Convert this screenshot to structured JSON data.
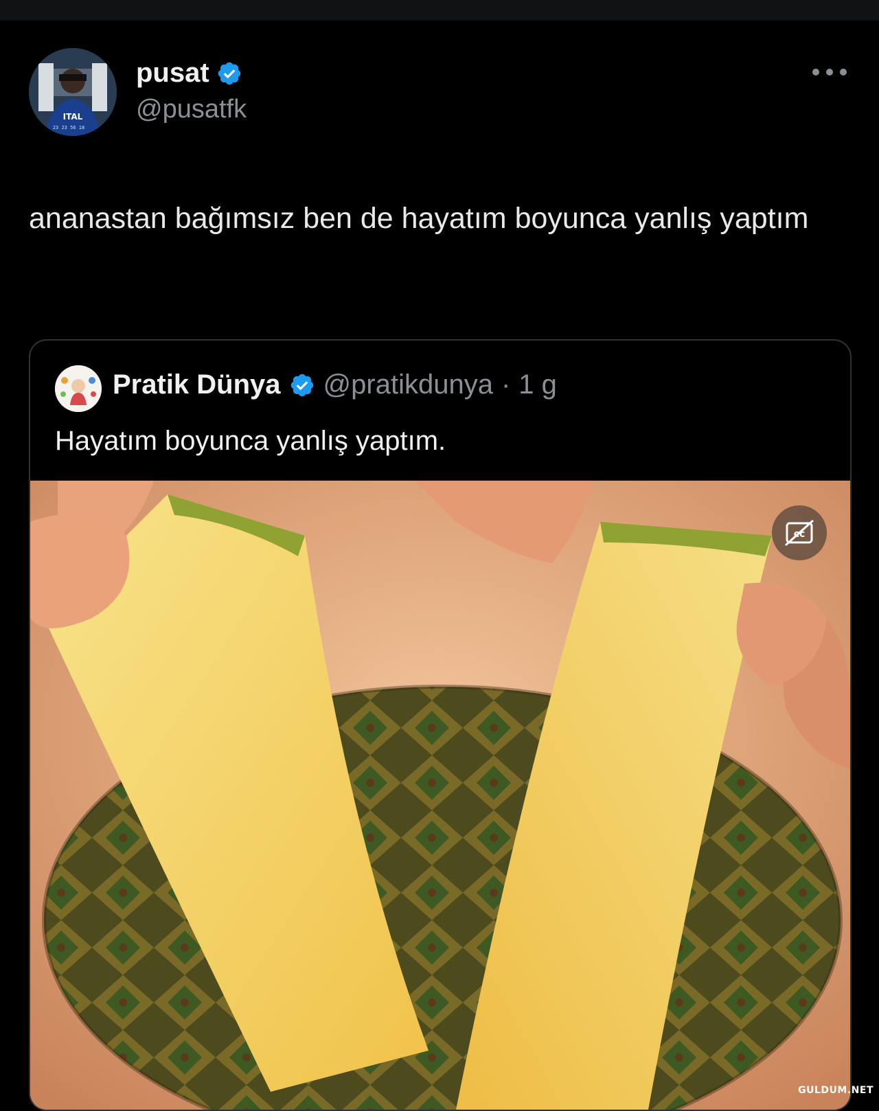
{
  "colors": {
    "background": "#000000",
    "verified": "#1d9bf0",
    "muted_text": "#8b9096"
  },
  "tweet": {
    "author_name": "pusat",
    "author_handle": "@pusatfk",
    "text": "ananastan bağımsız ben de hayatım boyunca yanlış yaptım",
    "more_icon": "more-horizontal-icon",
    "verified_icon": "verified-badge-icon"
  },
  "quoted_tweet": {
    "author_name": "Pratik Dünya",
    "author_handle": "@pratikdunya",
    "separator": "·",
    "time": "1 g",
    "text": "Hayatım boyunca yanlış yaptım.",
    "media": {
      "kind": "video",
      "description_icon": "pineapple-video-thumbnail",
      "captions_icon": "captions-off-icon"
    }
  },
  "watermark": "GULDUM.NET"
}
